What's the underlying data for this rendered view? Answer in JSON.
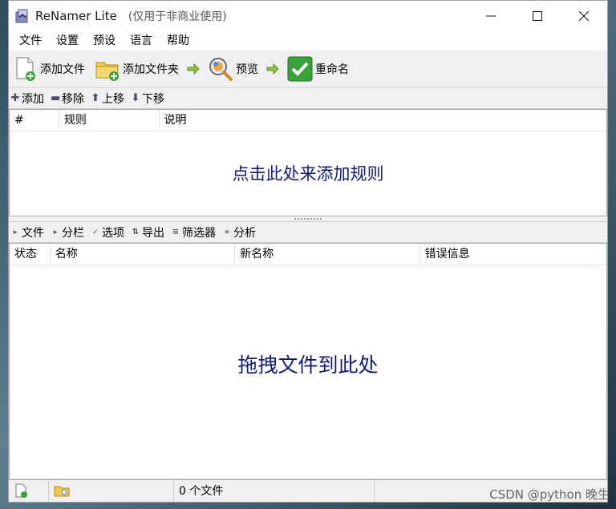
{
  "window": {
    "title": "ReNamer Lite",
    "subtitle": "(仅用于非商业使用)",
    "controls": {
      "minimize": "—",
      "maximize": "☐",
      "close": "✕"
    }
  },
  "menu": [
    "文件",
    "设置",
    "预设",
    "语言",
    "帮助"
  ],
  "toolbar": {
    "add_files": "添加文件",
    "add_folders": "添加文件夹",
    "preview": "预览",
    "rename": "重命名"
  },
  "rules_bar": {
    "add": "添加",
    "remove": "移除",
    "up": "上移",
    "down": "下移"
  },
  "rules_panel": {
    "columns": [
      "#",
      "规则",
      "说明"
    ],
    "placeholder": "点击此处来添加规则"
  },
  "files_bar": {
    "files": "文件",
    "columns": "分栏",
    "options": "选项",
    "export": "导出",
    "filter": "筛选器",
    "analyze": "分析"
  },
  "files_panel": {
    "columns": [
      "状态",
      "名称",
      "新名称",
      "错误信息"
    ],
    "placeholder": "拖拽文件到此处"
  },
  "status_bar": {
    "file_count": "0 个文件"
  },
  "watermark": "CSDN @python 晚生",
  "colors": {
    "placeholder": "#101a7a",
    "accent_green": "#3aa23a",
    "arrow_green": "#8cc63f"
  }
}
